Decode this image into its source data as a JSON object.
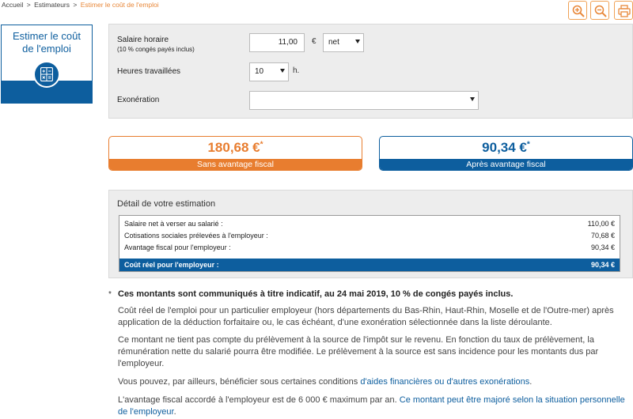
{
  "breadcrumb": {
    "home": "Accueil",
    "sep1": ">",
    "section": "Estimateurs",
    "sep2": ">",
    "current": "Estimer le coût de l'emploi"
  },
  "toolbar": {
    "zoom_in_icon": "zoom-in-icon",
    "zoom_out_icon": "zoom-out-icon",
    "print_icon": "print-icon",
    "accent": "#f0a155"
  },
  "title_card": {
    "line1": "Estimer le coût",
    "line2": "de l'emploi",
    "icon": "calculator-icon",
    "color": "#0d5e9e"
  },
  "form": {
    "wage_label": "Salaire horaire",
    "wage_sublabel": "(10 % congés payés inclus)",
    "wage_value": "11,00",
    "currency": "€",
    "wage_type": "net",
    "hours_label": "Heures travaillées",
    "hours_value": "10",
    "hours_unit": "h.",
    "exoneration_label": "Exonération",
    "exoneration_value": ""
  },
  "results": {
    "without": {
      "amount": "180,68 €",
      "mark": "*",
      "caption": "Sans avantage fiscal",
      "color": "#e87d2f"
    },
    "with": {
      "amount": "90,34 €",
      "mark": "*",
      "caption": "Après avantage fiscal",
      "color": "#0d5e9e"
    }
  },
  "detail": {
    "title": "Détail de votre estimation",
    "rows": [
      {
        "label": "Salaire net à verser au salarié :",
        "value": "110,00 €"
      },
      {
        "label": "Cotisations sociales prélevées à l'employeur :",
        "value": "70,68 €"
      },
      {
        "label": "Avantage fiscal pour l'employeur :",
        "value": "90,34 €"
      }
    ],
    "total": {
      "label": "Coût réel pour l'employeur :",
      "value": "90,34 €"
    }
  },
  "notes": {
    "star": "*",
    "headline": "Ces montants sont communiqués à titre indicatif, au 24 mai 2019, 10 % de congés payés inclus.",
    "p1": "Coût réel de l'emploi pour un particulier employeur (hors départements du Bas-Rhin, Haut-Rhin, Moselle et de l'Outre-mer) après application de la déduction forfaitaire ou, le cas échéant, d'une exonération sélectionnée dans la liste déroulante.",
    "p2": "Ce montant ne tient pas compte du prélèvement à la source de l'impôt sur le revenu. En fonction du taux de prélèvement, la rémunération nette du salarié pourra être modifiée. Le prélèvement à la source est sans incidence pour les montants dus par l'employeur.",
    "p3_text": "Vous pouvez, par ailleurs, bénéficier sous certaines conditions ",
    "p3_link": "d'aides financières ou d'autres exonérations",
    "p3_end": ".",
    "p4_text": "L'avantage fiscal accordé à l'employeur est de 6 000 € maximum par an. ",
    "p4_link": "Ce montant peut être majoré selon la situation personnelle de l'employeur",
    "p4_end": "."
  }
}
